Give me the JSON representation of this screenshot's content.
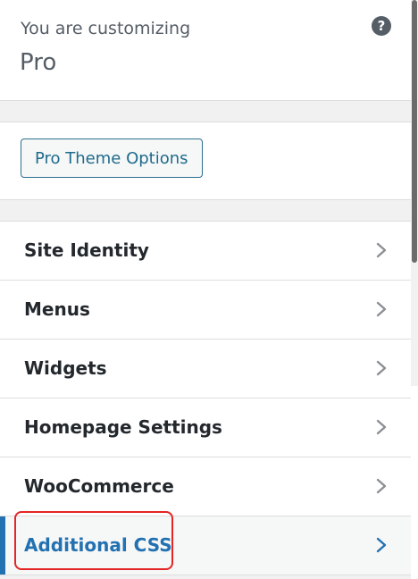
{
  "header": {
    "intro": "You are customizing",
    "theme_name": "Pro",
    "help_icon": "question-circle-icon",
    "help_glyph": "?"
  },
  "theme_options_button": {
    "label": "Pro Theme Options"
  },
  "sections": [
    {
      "label": "Site Identity",
      "active": false
    },
    {
      "label": "Menus",
      "active": false
    },
    {
      "label": "Widgets",
      "active": false
    },
    {
      "label": "Homepage Settings",
      "active": false
    },
    {
      "label": "WooCommerce",
      "active": false
    },
    {
      "label": "Additional CSS",
      "active": true
    }
  ],
  "colors": {
    "accent": "#2271b1",
    "highlight_border": "#e32525",
    "text": "#23282d",
    "muted": "#555d66"
  }
}
